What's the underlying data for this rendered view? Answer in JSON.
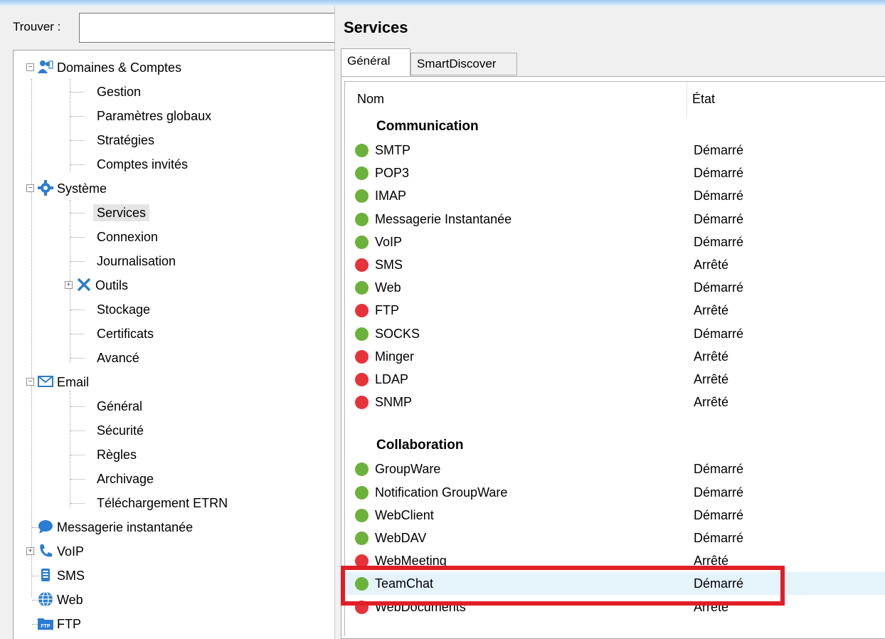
{
  "colors": {
    "started": "#6ab23a",
    "stopped": "#e8323a",
    "highlight": "#e01e26"
  },
  "find": {
    "label": "Trouver :",
    "value": ""
  },
  "tree": {
    "domains": {
      "label": "Domaines & Comptes",
      "icon": "users-icon",
      "children": [
        "Gestion",
        "Paramètres globaux",
        "Stratégies",
        "Comptes invités"
      ]
    },
    "system": {
      "label": "Système",
      "icon": "gear-icon",
      "children": [
        "Services",
        "Connexion",
        "Journalisation",
        "Outils",
        "Stockage",
        "Certificats",
        "Avancé"
      ],
      "selected": "Services"
    },
    "email": {
      "label": "Email",
      "icon": "envelope-icon",
      "children": [
        "Général",
        "Sécurité",
        "Règles",
        "Archivage",
        "Téléchargement ETRN"
      ]
    },
    "im": {
      "label": "Messagerie instantanée",
      "icon": "chat-bubble-icon"
    },
    "voip": {
      "label": "VoIP",
      "icon": "phone-icon"
    },
    "sms": {
      "label": "SMS",
      "icon": "sms-icon"
    },
    "web": {
      "label": "Web",
      "icon": "globe-icon"
    },
    "ftp": {
      "label": "FTP",
      "icon": "ftp-folder-icon",
      "badge": "FTP"
    }
  },
  "panel": {
    "title": "Services",
    "tabs": [
      "Général",
      "SmartDiscover"
    ],
    "active_tab": "Général",
    "columns": {
      "name": "Nom",
      "state": "État"
    },
    "groups": [
      {
        "label": "Communication",
        "services": [
          {
            "name": "SMTP",
            "state": "Démarré",
            "running": true
          },
          {
            "name": "POP3",
            "state": "Démarré",
            "running": true
          },
          {
            "name": "IMAP",
            "state": "Démarré",
            "running": true
          },
          {
            "name": "Messagerie Instantanée",
            "state": "Démarré",
            "running": true
          },
          {
            "name": "VoIP",
            "state": "Démarré",
            "running": true
          },
          {
            "name": "SMS",
            "state": "Arrêté",
            "running": false
          },
          {
            "name": "Web",
            "state": "Démarré",
            "running": true
          },
          {
            "name": "FTP",
            "state": "Arrêté",
            "running": false
          },
          {
            "name": "SOCKS",
            "state": "Démarré",
            "running": true
          },
          {
            "name": "Minger",
            "state": "Arrêté",
            "running": false
          },
          {
            "name": "LDAP",
            "state": "Arrêté",
            "running": false
          },
          {
            "name": "SNMP",
            "state": "Arrêté",
            "running": false
          }
        ]
      },
      {
        "label": "Collaboration",
        "services": [
          {
            "name": "GroupWare",
            "state": "Démarré",
            "running": true
          },
          {
            "name": "Notification GroupWare",
            "state": "Démarré",
            "running": true
          },
          {
            "name": "WebClient",
            "state": "Démarré",
            "running": true
          },
          {
            "name": "WebDAV",
            "state": "Démarré",
            "running": true
          },
          {
            "name": "WebMeeting",
            "state": "Arrêté",
            "running": false
          },
          {
            "name": "TeamChat",
            "state": "Démarré",
            "running": true
          },
          {
            "name": "WebDocuments",
            "state": "Arrêté",
            "running": false
          }
        ]
      }
    ],
    "selected_service": "TeamChat"
  }
}
